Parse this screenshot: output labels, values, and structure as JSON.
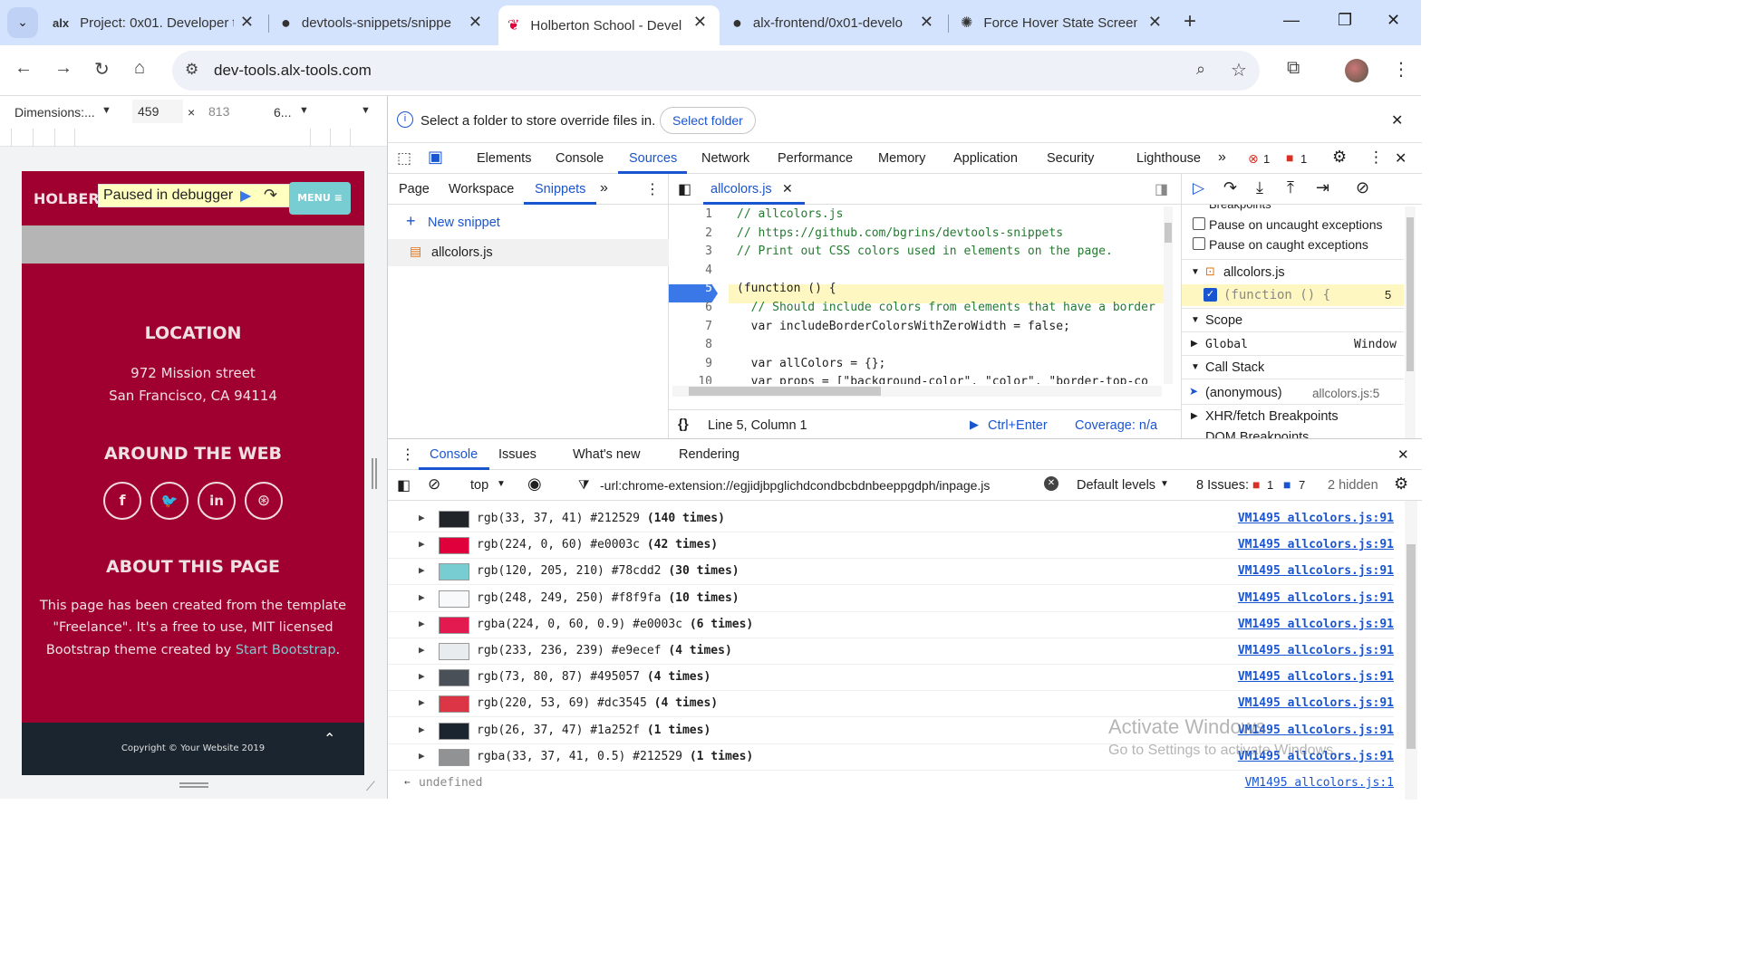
{
  "browser": {
    "tabs": [
      {
        "title": "Project: 0x01. Developer t",
        "icon": "alx-logo"
      },
      {
        "title": "devtools-snippets/snippe",
        "icon": "github-icon"
      },
      {
        "title": "Holberton School - Devel",
        "icon": "holberton-icon",
        "active": true
      },
      {
        "title": "alx-frontend/0x01-develo",
        "icon": "github-icon"
      },
      {
        "title": "Force Hover State Screen",
        "icon": "openai-icon"
      }
    ],
    "alx_logo_text": "alx",
    "url": "dev-tools.alx-tools.com"
  },
  "device_toolbar": {
    "dimensions_label": "Dimensions:...",
    "width": "459",
    "times": "×",
    "height": "813",
    "zoom": "6..."
  },
  "site": {
    "brand": "HOLBER",
    "paused_text": "Paused in debugger",
    "menu_label": "MENU",
    "location_heading": "LOCATION",
    "address_line1": "972 Mission street",
    "address_line2": "San Francisco, CA 94114",
    "web_heading": "AROUND THE WEB",
    "about_heading": "ABOUT THIS PAGE",
    "about_text1": "This page has been created from the template",
    "about_text2": "\"Freelance\". It's a free to use, MIT licensed",
    "about_text3": "Bootstrap theme created by",
    "about_link": "Start Bootstrap",
    "about_period": ".",
    "copyright": "Copyright © Your Website 2019"
  },
  "devtools": {
    "override_msg": "Select a folder to store override files in.",
    "select_folder": "Select folder",
    "main_tabs": [
      "Elements",
      "Console",
      "Sources",
      "Network",
      "Performance",
      "Memory",
      "Application",
      "Security",
      "Lighthouse"
    ],
    "error_count": "1",
    "issue_count": "1",
    "nav_tabs": [
      "Page",
      "Workspace",
      "Snippets"
    ],
    "new_snippet": "New snippet",
    "snippet_file": "allcolors.js",
    "editor_tab": "allcolors.js",
    "code_lines": [
      {
        "n": "1",
        "t": "// allcolors.js"
      },
      {
        "n": "2",
        "t": "// https://github.com/bgrins/devtools-snippets"
      },
      {
        "n": "3",
        "t": "// Print out CSS colors used in elements on the page."
      },
      {
        "n": "4",
        "t": ""
      },
      {
        "n": "5",
        "t": "(function () {"
      },
      {
        "n": "6",
        "t": "  // Should include colors from elements that have a border"
      },
      {
        "n": "7",
        "t": "  var includeBorderColorsWithZeroWidth = false;"
      },
      {
        "n": "8",
        "t": ""
      },
      {
        "n": "9",
        "t": "  var allColors = {};"
      },
      {
        "n": "10",
        "t": "  var props = [\"background-color\", \"color\", \"border-top-co"
      }
    ],
    "status_position": "Line 5, Column 1",
    "run_shortcut": "Ctrl+Enter",
    "coverage": "Coverage: n/a",
    "debugger": {
      "breakpoints_label": "Breakpoints",
      "pause_uncaught": "Pause on uncaught exceptions",
      "pause_caught": "Pause on caught exceptions",
      "bp_file": "allcolors.js",
      "bp_code": "(function () {",
      "bp_line": "5",
      "scope": "Scope",
      "global": "Global",
      "global_val": "Window",
      "call_stack": "Call Stack",
      "frame_name": "(anonymous)",
      "frame_loc": "allcolors.js:5",
      "xhr": "XHR/fetch Breakpoints",
      "dom": "DOM Breakpoints"
    },
    "drawer_tabs": [
      "Console",
      "Issues",
      "What's new",
      "Rendering"
    ],
    "context": "top",
    "filter": "-url:chrome-extension://egjidjbpglichdcondbcbdnbeeppgdph/inpage.js",
    "levels": "Default levels",
    "issues_label": "8 Issues:",
    "issues_err": "1",
    "issues_info": "7",
    "hidden": "2 hidden",
    "log_rows": [
      {
        "text": "rgb(33, 37, 41) #212529",
        "count": "(140 times)",
        "color": "#212529",
        "src": "VM1495 allcolors.js:91"
      },
      {
        "text": "rgb(224, 0, 60) #e0003c",
        "count": "(42 times)",
        "color": "#e0003c",
        "src": "VM1495 allcolors.js:91"
      },
      {
        "text": "rgb(120, 205, 210) #78cdd2",
        "count": "(30 times)",
        "color": "#78cdd2",
        "src": "VM1495 allcolors.js:91"
      },
      {
        "text": "rgb(248, 249, 250) #f8f9fa",
        "count": "(10 times)",
        "color": "#f8f9fa",
        "src": "VM1495 allcolors.js:91"
      },
      {
        "text": "rgba(224, 0, 60, 0.9) #e0003c",
        "count": "(6 times)",
        "color": "#e31a4f",
        "src": "VM1495 allcolors.js:91"
      },
      {
        "text": "rgb(233, 236, 239) #e9ecef",
        "count": "(4 times)",
        "color": "#e9ecef",
        "src": "VM1495 allcolors.js:91"
      },
      {
        "text": "rgb(73, 80, 87) #495057",
        "count": "(4 times)",
        "color": "#495057",
        "src": "VM1495 allcolors.js:91"
      },
      {
        "text": "rgb(220, 53, 69) #dc3545",
        "count": "(4 times)",
        "color": "#dc3545",
        "src": "VM1495 allcolors.js:91"
      },
      {
        "text": "rgb(26, 37, 47) #1a252f",
        "count": "(1 times)",
        "color": "#1a252f",
        "src": "VM1495 allcolors.js:91"
      },
      {
        "text": "rgba(33, 37, 41, 0.5) #212529",
        "count": "(1 times)",
        "color": "#909294",
        "src": "VM1495 allcolors.js:91"
      }
    ],
    "result": "undefined",
    "result_src": "VM1495 allcolors.js:1"
  },
  "watermark": {
    "line1": "Activate Windows",
    "line2": "Go to Settings to activate Windows."
  }
}
